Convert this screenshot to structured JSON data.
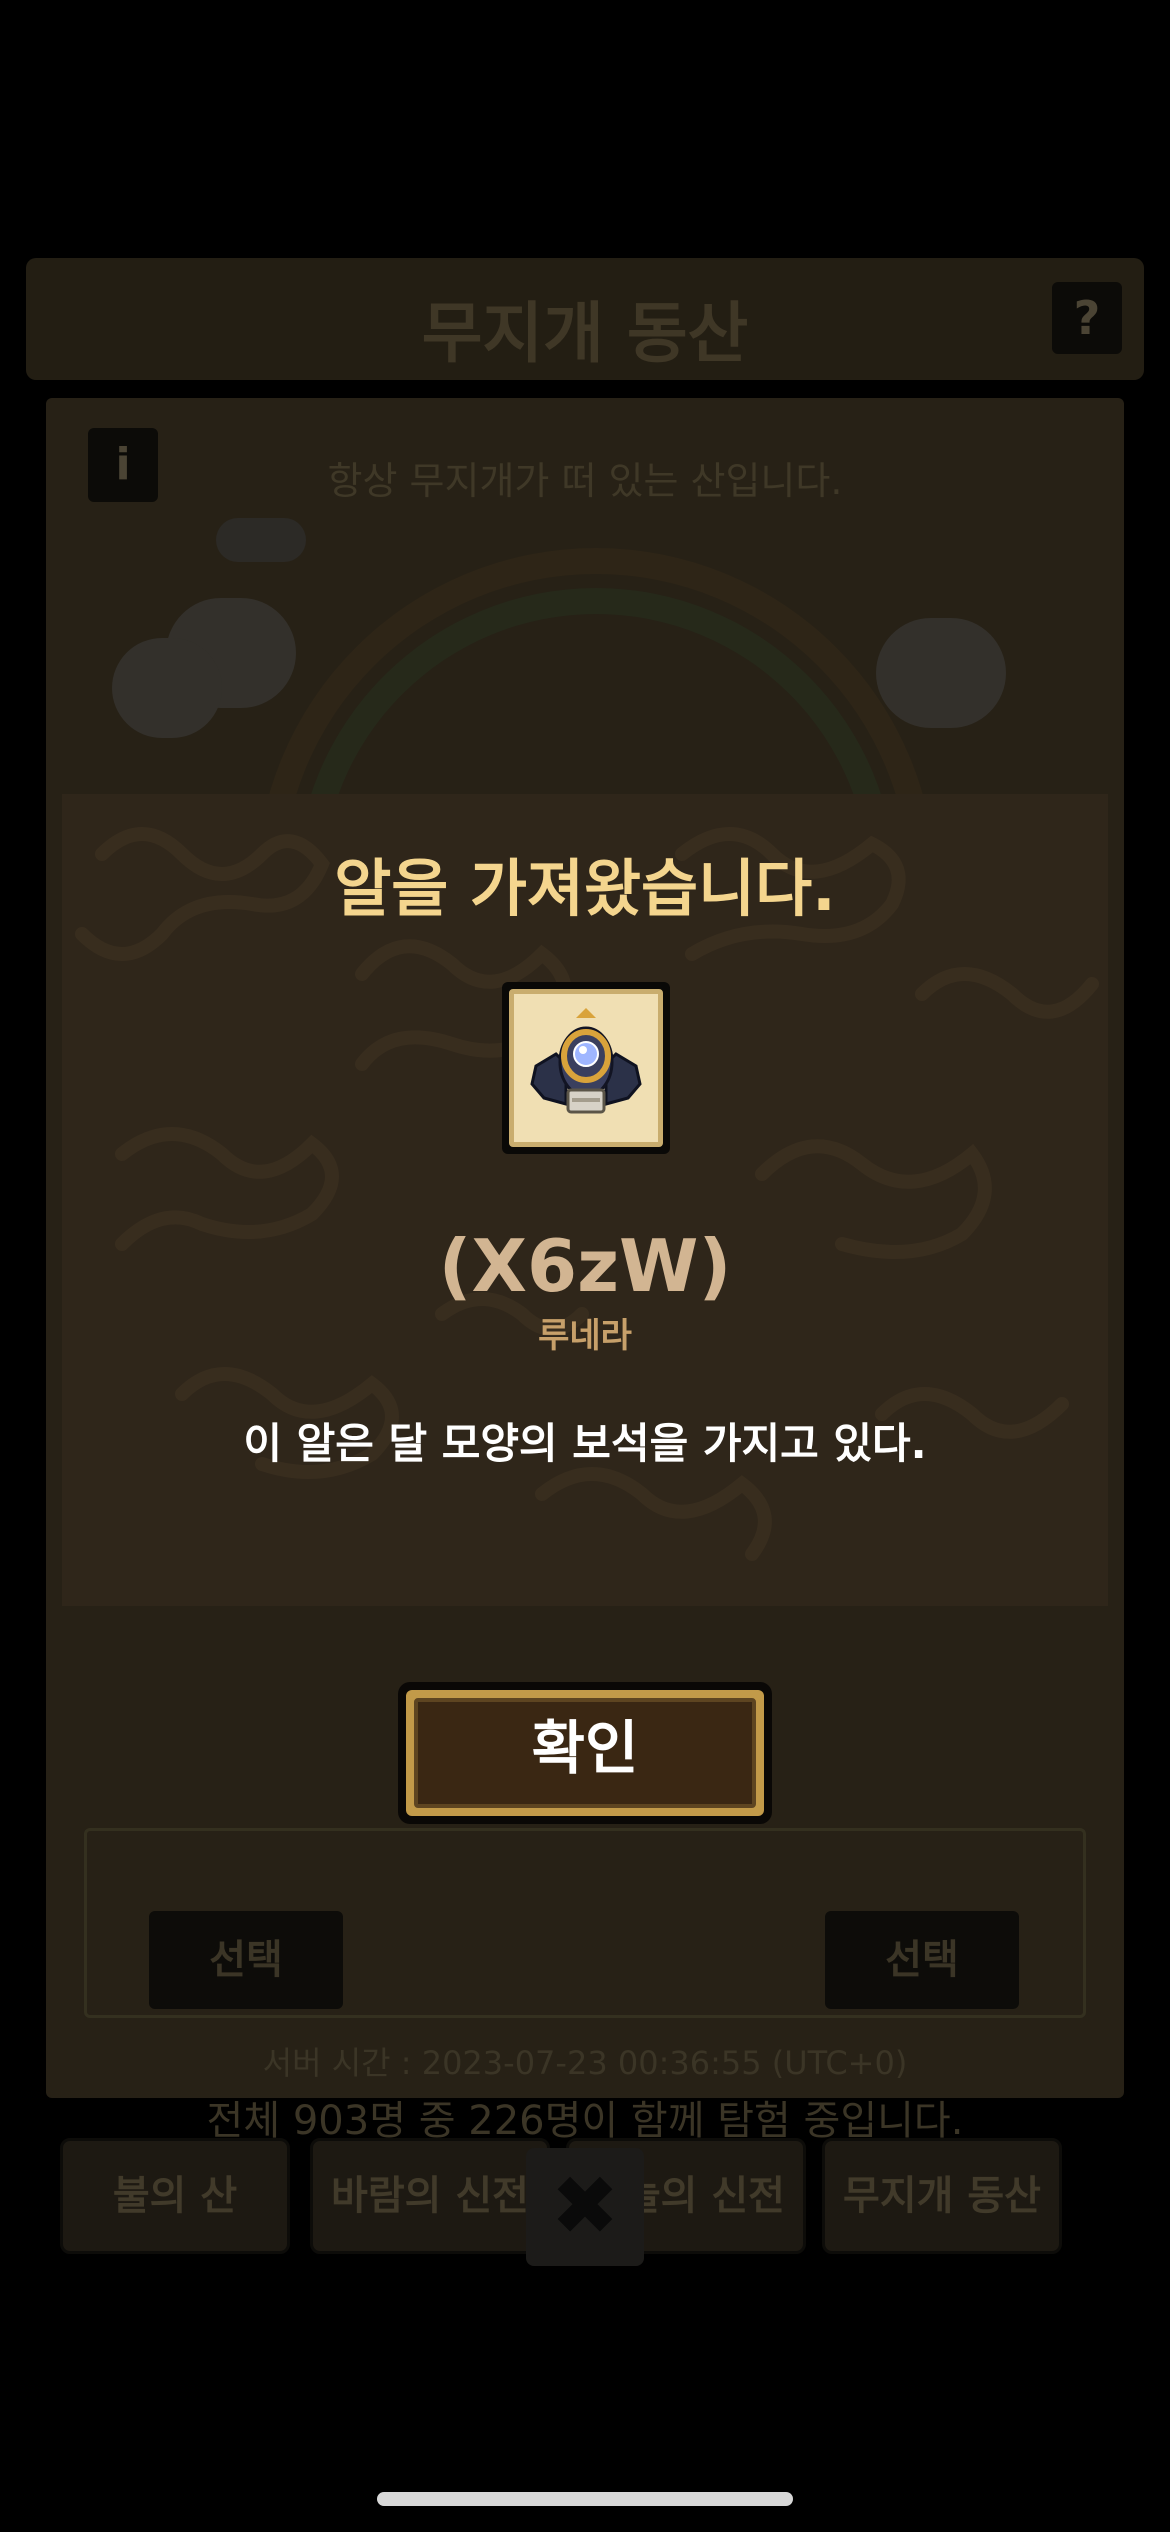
{
  "background": {
    "title": "무지개 동산",
    "help_label": "?",
    "info_label": "i",
    "description": "항상 무지개가 떠 있는 산입니다.",
    "slot_buttons": [
      "선택",
      "선택"
    ],
    "server_time": "서버 시간 : 2023-07-23 00:36:55 (UTC+0)",
    "participant_count": "전체 903명 중 226명이 함께 탐험 중입니다.",
    "tabs": [
      "불의 산",
      "바람의 신전",
      "하늘의 신전",
      "무지개 동산"
    ],
    "close_label": "✖"
  },
  "modal": {
    "title": "알을 가져왔습니다.",
    "egg_name": "(X6zW)",
    "egg_species": "루네라",
    "egg_description": "이 알은 달 모양의 보석을 가지고 있다."
  },
  "confirm_button": {
    "label": "확인"
  },
  "colors": {
    "modal_bg": "#2f261a",
    "title_gold": "#f4d58e",
    "egg_name": "#d2b592",
    "species": "#c7a06a",
    "button_face": "#3a2713",
    "button_border": "#c29a49"
  }
}
